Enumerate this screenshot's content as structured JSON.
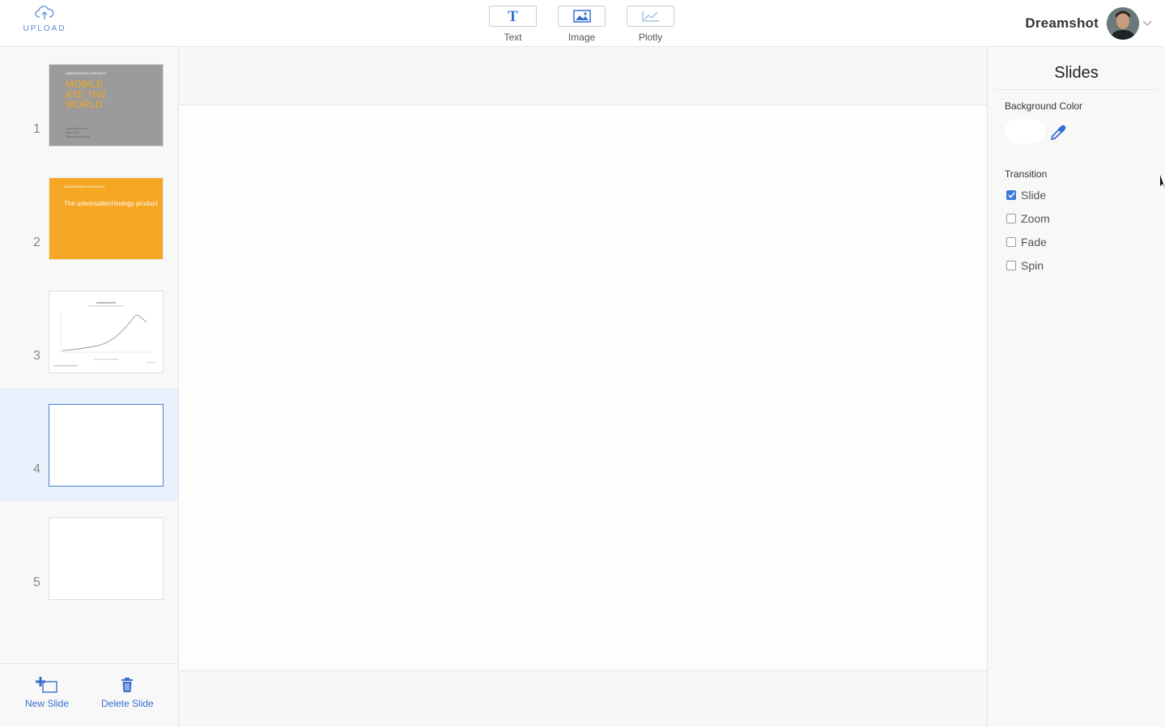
{
  "topbar": {
    "upload_label": "UPLOAD",
    "tools": [
      {
        "label": "Text",
        "icon": "text-icon"
      },
      {
        "label": "Image",
        "icon": "image-icon"
      },
      {
        "label": "Plotly",
        "icon": "chart-line-icon"
      }
    ],
    "user": {
      "name": "Dreamshot"
    }
  },
  "slides": [
    {
      "number": "1",
      "theme": "gray",
      "title_lines": [
        "MOBILE",
        "ATE THE",
        "WORLD"
      ]
    },
    {
      "number": "2",
      "theme": "orange",
      "text": "The universaltechnology product"
    },
    {
      "number": "3",
      "theme": "chart"
    },
    {
      "number": "4",
      "theme": "blank",
      "selected": true
    },
    {
      "number": "5",
      "theme": "blank"
    }
  ],
  "sidebar_actions": {
    "new_slide": "New Slide",
    "delete_slide": "Delete Slide"
  },
  "panel": {
    "title": "Slides",
    "background_color_label": "Background Color",
    "background_color": "#ffffff",
    "transition_label": "Transition",
    "transitions": [
      {
        "label": "Slide",
        "checked": true
      },
      {
        "label": "Zoom",
        "checked": false
      },
      {
        "label": "Fade",
        "checked": false
      },
      {
        "label": "Spin",
        "checked": false
      }
    ]
  },
  "colors": {
    "accent": "#3a6fd0",
    "orange": "#f5a623",
    "selected_row": "#e8f1fc"
  }
}
